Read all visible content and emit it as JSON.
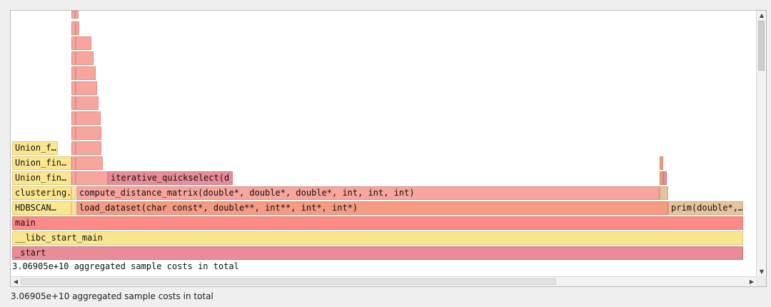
{
  "flamegraph": {
    "total_text": "3.06905e+10 aggregated sample costs in total",
    "frames": {
      "start": "_start",
      "libc_start_main": "__libc_start_main",
      "main": "main",
      "hdbscan": "HDBSCAN…",
      "load_dataset": "load_dataset(char const*, double**, int**, int*, int*)",
      "prim": "prim(double*,…",
      "clustering": "clustering.",
      "compute_distance_matrix": "compute_distance_matrix(double*, double*, double*, int, int, int)",
      "union_fin_1": "Union_fin…",
      "iterative_quickselect": "iterative_quickselect(d",
      "union_fin_2": "Union_fin…",
      "union_f": "Union_f…"
    },
    "colors": {
      "yellow": "#fbe68f",
      "salmon": "#f7a59d",
      "red": "#fc8a86",
      "pink": "#e98c97",
      "tan": "#e8c29b"
    }
  },
  "status_bar": {
    "text": "3.06905e+10 aggregated sample costs in total"
  },
  "scrollbars": {
    "up_arrow": "▲",
    "down_arrow": "▼",
    "left_arrow": "◀",
    "right_arrow": "▶"
  }
}
